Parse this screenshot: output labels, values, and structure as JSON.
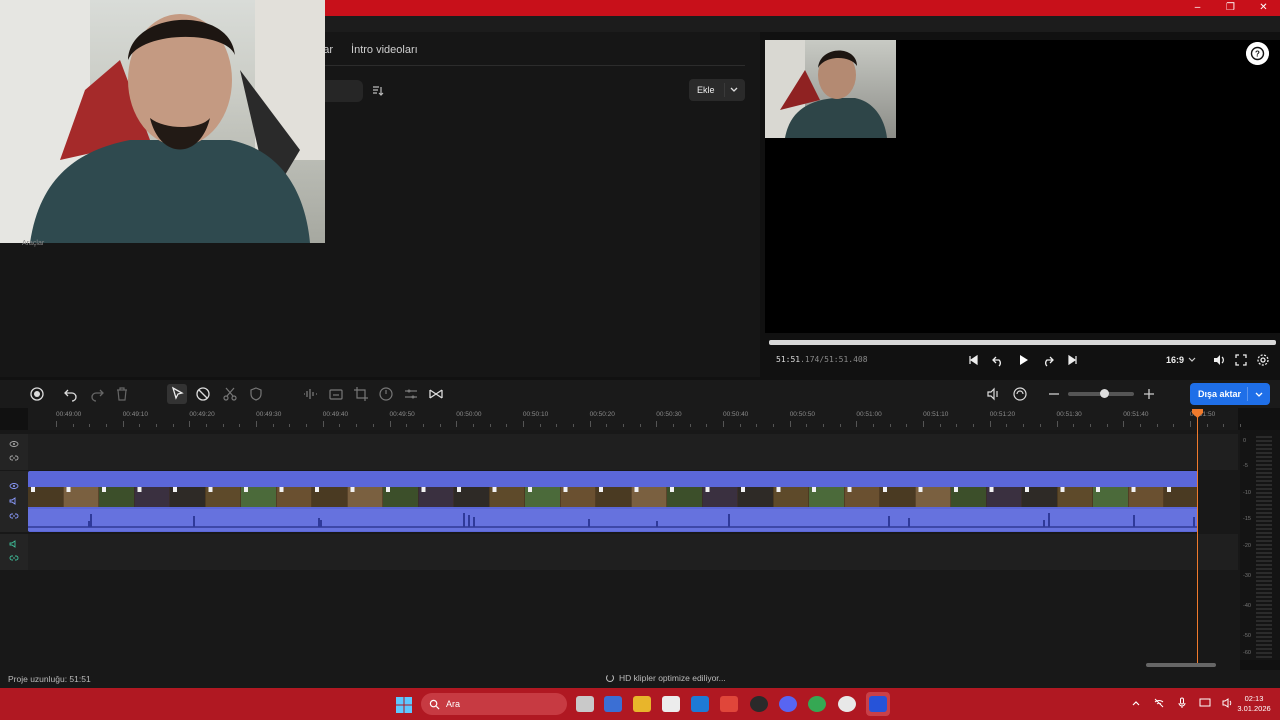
{
  "window": {
    "controls": [
      "–",
      "❐",
      "✕"
    ]
  },
  "library": {
    "tabs": [
      "planlar",
      "İntro videoları"
    ],
    "add_label": "Ekle",
    "tools_label": "Araçlar"
  },
  "player": {
    "time_current": "51:51",
    "time_current_ms": ".174",
    "time_total": "/51:51.408",
    "aspect_ratio": "16:9",
    "progress": 1.0
  },
  "toolbar": {
    "export_label": "Dışa aktar",
    "zoom_level": 0.55
  },
  "timeline": {
    "ruler_labels": [
      "00:49:00",
      "00:49:10",
      "00:49:20",
      "00:49:30",
      "00:49:40",
      "00:49:50",
      "00:50:00",
      "00:50:10",
      "00:50:20",
      "00:50:30",
      "00:50:40",
      "00:50:50",
      "00:51:00",
      "00:51:10",
      "00:51:20",
      "00:51:30",
      "00:51:40",
      "00:51:50"
    ],
    "meter_labels": [
      "0",
      "-5",
      "-10",
      "-15",
      "-20",
      "-30",
      "-40",
      "-50",
      "-60"
    ]
  },
  "status": {
    "project_length": "Proje uzunluğu: 51:51",
    "optimizing": "HD klipler optimize ediliyor..."
  },
  "taskbar": {
    "search_placeholder": "Ara",
    "time": "02:13",
    "date": "3.01.2026"
  },
  "colors": {
    "titlebar": "#c8101a",
    "taskbar": "#b01822",
    "accent": "#1f6fe8",
    "clip": "#5b67d9",
    "playhead": "#f07a2c"
  }
}
